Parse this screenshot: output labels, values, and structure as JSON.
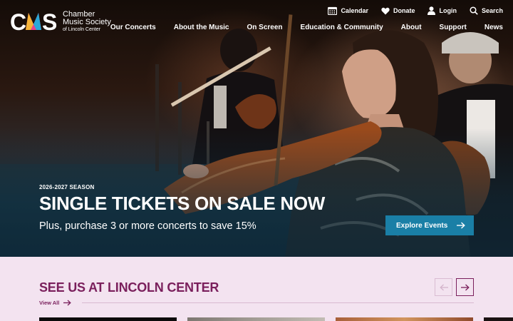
{
  "brand": {
    "line1": "Chamber",
    "line2": "Music Society",
    "line3": "of Lincoln Center",
    "colors": {
      "teal": "#1a7fa6",
      "plum": "#7a1f5c",
      "pink_bg": "#f3e3f0"
    }
  },
  "utility_nav": [
    {
      "label": "Calendar",
      "icon": "calendar-icon"
    },
    {
      "label": "Donate",
      "icon": "heart-icon"
    },
    {
      "label": "Login",
      "icon": "user-icon"
    },
    {
      "label": "Search",
      "icon": "search-icon"
    }
  ],
  "main_nav": [
    "Our Concerts",
    "About the Music",
    "On Screen",
    "Education & Community",
    "About",
    "Support",
    "News"
  ],
  "hero": {
    "season": "2026-2027 SEASON",
    "headline": "SINGLE TICKETS ON SALE NOW",
    "subline": "Plus, purchase 3 or more concerts to save 15%",
    "cta": "Explore Events"
  },
  "section": {
    "title": "SEE US AT LINCOLN CENTER",
    "view_all": "View All"
  }
}
